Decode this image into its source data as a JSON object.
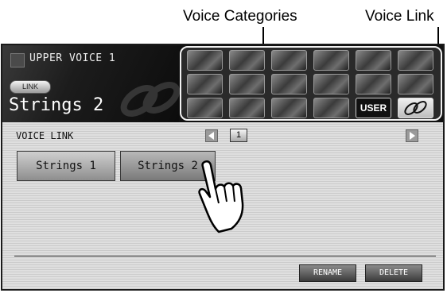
{
  "callouts": {
    "categories": "Voice Categories",
    "voice_link": "Voice Link"
  },
  "header": {
    "part": "UPPER VOICE 1",
    "link_badge": "LINK",
    "voice": "Strings 2"
  },
  "categories": [
    "strings-icon",
    "brass-icon",
    "trumpet-icon",
    "flute-icon",
    "woodwind-icon",
    "choir-icon",
    "harp-icon",
    "synth-keyboard-icon",
    "organ-icon",
    "piano-icon",
    "guitar-icon",
    "percussion-icon",
    "bell-icon",
    "bass-icon",
    "drum-kit-icon",
    "keyboard-icon",
    "user-category",
    "voice-link-icon"
  ],
  "user_label": "USER",
  "main": {
    "strip_label": "VOICE LINK",
    "page_number": "1",
    "voices": [
      {
        "label": "Strings 1",
        "selected": false
      },
      {
        "label": "Strings 2",
        "selected": true
      }
    ],
    "rename_label": "RENAME",
    "delete_label": "DELETE"
  }
}
